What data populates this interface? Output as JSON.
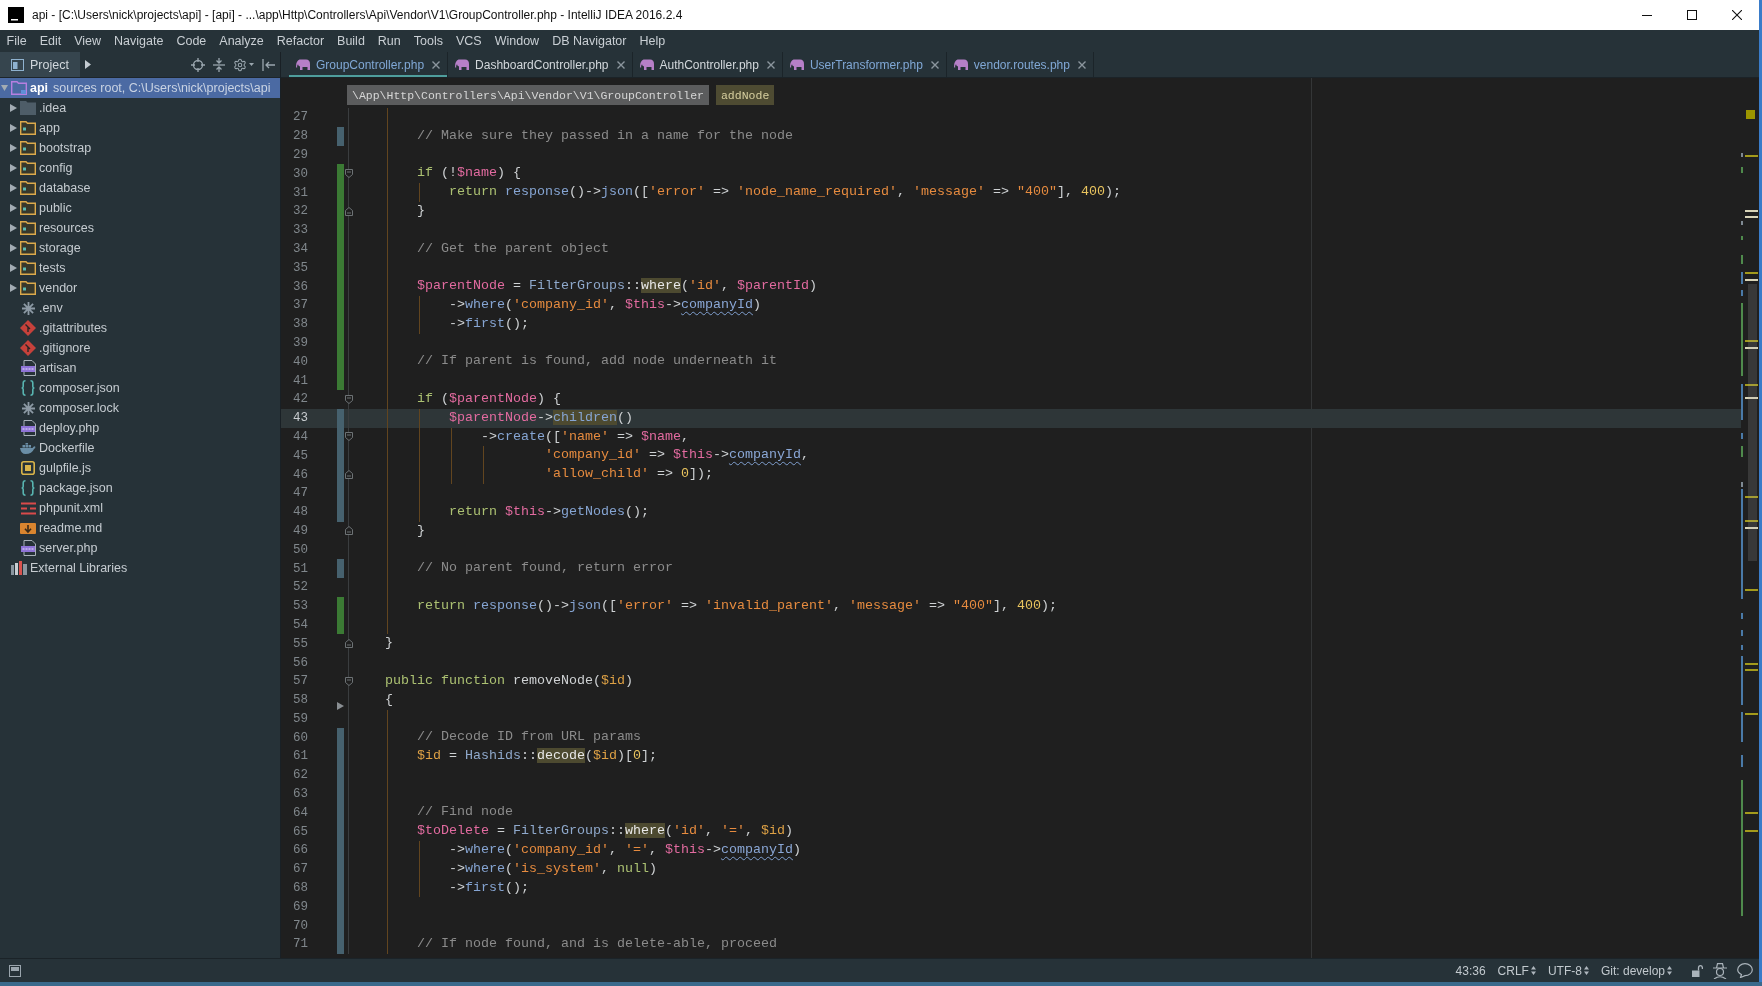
{
  "window": {
    "title": "api - [C:\\Users\\nick\\projects\\api] - [api] - ...\\app\\Http\\Controllers\\Api\\Vendor\\V1\\GroupController.php - IntelliJ IDEA 2016.2.4"
  },
  "menu": [
    "File",
    "Edit",
    "View",
    "Navigate",
    "Code",
    "Analyze",
    "Refactor",
    "Build",
    "Run",
    "Tools",
    "VCS",
    "Window",
    "DB Navigator",
    "Help"
  ],
  "project_panel": {
    "title": "Project",
    "tree": [
      {
        "kind": "module",
        "name": "api",
        "hint": "sources root, C:\\Users\\nick\\projects\\api",
        "expanded": true,
        "selected": true,
        "children": [
          {
            "kind": "excluded-folder",
            "name": ".idea",
            "expanded": false,
            "selected": false
          },
          {
            "kind": "folder",
            "name": "app",
            "expanded": false,
            "selected": false
          },
          {
            "kind": "folder",
            "name": "bootstrap",
            "expanded": false,
            "selected": false
          },
          {
            "kind": "folder",
            "name": "config",
            "expanded": false,
            "selected": false
          },
          {
            "kind": "folder",
            "name": "database",
            "expanded": false,
            "selected": false
          },
          {
            "kind": "folder",
            "name": "public",
            "expanded": false,
            "selected": false
          },
          {
            "kind": "folder",
            "name": "resources",
            "expanded": false,
            "selected": false
          },
          {
            "kind": "folder",
            "name": "storage",
            "expanded": false,
            "selected": false
          },
          {
            "kind": "folder",
            "name": "tests",
            "expanded": false,
            "selected": false
          },
          {
            "kind": "folder",
            "name": "vendor",
            "expanded": false,
            "selected": false
          },
          {
            "kind": "config",
            "name": ".env",
            "selected": false
          },
          {
            "kind": "git",
            "name": ".gitattributes",
            "selected": false
          },
          {
            "kind": "git",
            "name": ".gitignore",
            "selected": false
          },
          {
            "kind": "php",
            "name": "artisan",
            "selected": false
          },
          {
            "kind": "json",
            "name": "composer.json",
            "selected": false
          },
          {
            "kind": "config",
            "name": "composer.lock",
            "selected": false
          },
          {
            "kind": "php",
            "name": "deploy.php",
            "selected": false
          },
          {
            "kind": "docker",
            "name": "Dockerfile",
            "selected": false
          },
          {
            "kind": "js",
            "name": "gulpfile.js",
            "selected": false
          },
          {
            "kind": "json",
            "name": "package.json",
            "selected": false
          },
          {
            "kind": "xml",
            "name": "phpunit.xml",
            "selected": false
          },
          {
            "kind": "markdown",
            "name": "readme.md",
            "selected": false
          },
          {
            "kind": "php",
            "name": "server.php",
            "selected": false
          }
        ]
      },
      {
        "kind": "libraries",
        "name": "External Libraries",
        "selected": false
      }
    ]
  },
  "tabs": [
    {
      "label": "GroupController.php",
      "selected": true,
      "modified": true
    },
    {
      "label": "DashboardController.php",
      "selected": false,
      "modified": false
    },
    {
      "label": "AuthController.php",
      "selected": false,
      "modified": false
    },
    {
      "label": "UserTransformer.php",
      "selected": false,
      "modified": true
    },
    {
      "label": "vendor.routes.php",
      "selected": false,
      "modified": true
    }
  ],
  "breadcrumbs": [
    {
      "label": "\\App\\Http\\Controllers\\Api\\Vendor\\V1\\GroupController",
      "selected": false
    },
    {
      "label": "addNode",
      "selected": true
    }
  ],
  "editor": {
    "lines": [
      {
        "number": "27",
        "added": false,
        "modified": false,
        "deleted_below": false,
        "fold_start": false,
        "fold_end": false,
        "current": false
      },
      {
        "number": "28",
        "added": false,
        "modified": true,
        "deleted_below": false,
        "fold_start": false,
        "fold_end": false,
        "current": false,
        "tokens": [
          {
            "kind": "comment",
            "text": "        // Make sure they passed in a name for the node"
          }
        ]
      },
      {
        "number": "29",
        "added": false,
        "modified": false,
        "deleted_below": false,
        "fold_start": false,
        "fold_end": false,
        "current": false
      },
      {
        "number": "30",
        "added": true,
        "modified": false,
        "deleted_below": false,
        "fold_start": true,
        "fold_end": false,
        "current": false,
        "tokens": [
          {
            "kind": "keyword",
            "text": "        if"
          },
          {
            "kind": "plain",
            "text": " (!"
          },
          {
            "kind": "variable",
            "text": "$name"
          },
          {
            "kind": "plain",
            "text": ") {"
          }
        ]
      },
      {
        "number": "31",
        "added": true,
        "modified": false,
        "deleted_below": false,
        "fold_start": false,
        "fold_end": false,
        "current": false,
        "tokens": [
          {
            "kind": "keyword",
            "text": "            return "
          },
          {
            "kind": "call",
            "text": "response"
          },
          {
            "kind": "plain",
            "text": "()->"
          },
          {
            "kind": "call",
            "text": "json"
          },
          {
            "kind": "plain",
            "text": "(["
          },
          {
            "kind": "string",
            "text": "'error'"
          },
          {
            "kind": "plain",
            "text": " => "
          },
          {
            "kind": "string",
            "text": "'node_name_required'"
          },
          {
            "kind": "plain",
            "text": ", "
          },
          {
            "kind": "string",
            "text": "'message'"
          },
          {
            "kind": "plain",
            "text": " => "
          },
          {
            "kind": "string",
            "text": "\"400\""
          },
          {
            "kind": "plain",
            "text": "], "
          },
          {
            "kind": "number",
            "text": "400"
          },
          {
            "kind": "plain",
            "text": ");"
          }
        ]
      },
      {
        "number": "32",
        "added": true,
        "modified": false,
        "deleted_below": false,
        "fold_start": false,
        "fold_end": true,
        "current": false,
        "tokens": [
          {
            "kind": "plain",
            "text": "        }"
          }
        ]
      },
      {
        "number": "33",
        "added": true,
        "modified": false,
        "deleted_below": false,
        "fold_start": false,
        "fold_end": false,
        "current": false
      },
      {
        "number": "34",
        "added": true,
        "modified": false,
        "deleted_below": false,
        "fold_start": false,
        "fold_end": false,
        "current": false,
        "tokens": [
          {
            "kind": "comment",
            "text": "        // Get the parent object"
          }
        ]
      },
      {
        "number": "35",
        "added": true,
        "modified": false,
        "deleted_below": false,
        "fold_start": false,
        "fold_end": false,
        "current": false
      },
      {
        "number": "36",
        "added": true,
        "modified": false,
        "deleted_below": false,
        "fold_start": false,
        "fold_end": false,
        "current": false,
        "tokens": [
          {
            "kind": "variable",
            "text": "        $parentNode"
          },
          {
            "kind": "plain",
            "text": " = "
          },
          {
            "kind": "class",
            "text": "FilterGroups"
          },
          {
            "kind": "plain",
            "text": "::"
          },
          {
            "kind": "usage",
            "text": "where"
          },
          {
            "kind": "plain",
            "text": "("
          },
          {
            "kind": "string",
            "text": "'id'"
          },
          {
            "kind": "plain",
            "text": ", "
          },
          {
            "kind": "variable",
            "text": "$parentId"
          },
          {
            "kind": "plain",
            "text": ")"
          }
        ]
      },
      {
        "number": "37",
        "added": true,
        "modified": false,
        "deleted_below": false,
        "fold_start": false,
        "fold_end": false,
        "current": false,
        "tokens": [
          {
            "kind": "plain",
            "text": "            ->"
          },
          {
            "kind": "call",
            "text": "where"
          },
          {
            "kind": "plain",
            "text": "("
          },
          {
            "kind": "string",
            "text": "'company_id'"
          },
          {
            "kind": "plain",
            "text": ", "
          },
          {
            "kind": "variable",
            "text": "$this"
          },
          {
            "kind": "plain",
            "text": "->"
          },
          {
            "kind": "field-warning",
            "text": "companyId"
          },
          {
            "kind": "plain",
            "text": ")"
          }
        ]
      },
      {
        "number": "38",
        "added": true,
        "modified": false,
        "deleted_below": false,
        "fold_start": false,
        "fold_end": false,
        "current": false,
        "tokens": [
          {
            "kind": "plain",
            "text": "            ->"
          },
          {
            "kind": "call",
            "text": "first"
          },
          {
            "kind": "plain",
            "text": "();"
          }
        ]
      },
      {
        "number": "39",
        "added": true,
        "modified": false,
        "deleted_below": false,
        "fold_start": false,
        "fold_end": false,
        "current": false
      },
      {
        "number": "40",
        "added": true,
        "modified": false,
        "deleted_below": false,
        "fold_start": false,
        "fold_end": false,
        "current": false,
        "tokens": [
          {
            "kind": "comment",
            "text": "        // If parent is found, add node underneath it"
          }
        ]
      },
      {
        "number": "41",
        "added": true,
        "modified": false,
        "deleted_below": false,
        "fold_start": false,
        "fold_end": false,
        "current": false
      },
      {
        "number": "42",
        "added": false,
        "modified": false,
        "deleted_below": false,
        "fold_start": true,
        "fold_end": false,
        "current": false,
        "tokens": [
          {
            "kind": "keyword",
            "text": "        if"
          },
          {
            "kind": "plain",
            "text": " ("
          },
          {
            "kind": "variable",
            "text": "$parentNode"
          },
          {
            "kind": "plain",
            "text": ") {"
          }
        ]
      },
      {
        "number": "43",
        "added": false,
        "modified": true,
        "deleted_below": false,
        "fold_start": false,
        "fold_end": false,
        "current": true,
        "tokens": [
          {
            "kind": "variable",
            "text": "            $parentNode"
          },
          {
            "kind": "plain",
            "text": "->"
          },
          {
            "kind": "call-usage",
            "text": "children"
          },
          {
            "kind": "plain",
            "text": "()"
          }
        ]
      },
      {
        "number": "44",
        "added": false,
        "modified": true,
        "deleted_below": false,
        "fold_start": true,
        "fold_end": false,
        "current": false,
        "tokens": [
          {
            "kind": "plain",
            "text": "                ->"
          },
          {
            "kind": "call",
            "text": "create"
          },
          {
            "kind": "plain",
            "text": "(["
          },
          {
            "kind": "string",
            "text": "'name'"
          },
          {
            "kind": "plain",
            "text": " => "
          },
          {
            "kind": "variable",
            "text": "$name"
          },
          {
            "kind": "plain",
            "text": ","
          }
        ]
      },
      {
        "number": "45",
        "added": false,
        "modified": true,
        "deleted_below": false,
        "fold_start": false,
        "fold_end": false,
        "current": false,
        "tokens": [
          {
            "kind": "string",
            "text": "                        'company_id'"
          },
          {
            "kind": "plain",
            "text": " => "
          },
          {
            "kind": "variable",
            "text": "$this"
          },
          {
            "kind": "plain",
            "text": "->"
          },
          {
            "kind": "field-warning",
            "text": "companyId"
          },
          {
            "kind": "plain",
            "text": ","
          }
        ]
      },
      {
        "number": "46",
        "added": false,
        "modified": true,
        "deleted_below": false,
        "fold_start": false,
        "fold_end": true,
        "current": false,
        "tokens": [
          {
            "kind": "string",
            "text": "                        'allow_child'"
          },
          {
            "kind": "plain",
            "text": " => "
          },
          {
            "kind": "number",
            "text": "0"
          },
          {
            "kind": "plain",
            "text": "]);"
          }
        ]
      },
      {
        "number": "47",
        "added": false,
        "modified": true,
        "deleted_below": false,
        "fold_start": false,
        "fold_end": false,
        "current": false
      },
      {
        "number": "48",
        "added": false,
        "modified": true,
        "deleted_below": false,
        "fold_start": false,
        "fold_end": false,
        "current": false,
        "tokens": [
          {
            "kind": "keyword",
            "text": "            return "
          },
          {
            "kind": "variable",
            "text": "$this"
          },
          {
            "kind": "plain",
            "text": "->"
          },
          {
            "kind": "call",
            "text": "getNodes"
          },
          {
            "kind": "plain",
            "text": "();"
          }
        ]
      },
      {
        "number": "49",
        "added": false,
        "modified": false,
        "deleted_below": false,
        "fold_start": false,
        "fold_end": true,
        "current": false,
        "tokens": [
          {
            "kind": "plain",
            "text": "        }"
          }
        ]
      },
      {
        "number": "50",
        "added": false,
        "modified": false,
        "deleted_below": false,
        "fold_start": false,
        "fold_end": false,
        "current": false
      },
      {
        "number": "51",
        "added": false,
        "modified": true,
        "deleted_below": false,
        "fold_start": false,
        "fold_end": false,
        "current": false,
        "tokens": [
          {
            "kind": "comment",
            "text": "        // No parent found, return error"
          }
        ]
      },
      {
        "number": "52",
        "added": false,
        "modified": false,
        "deleted_below": false,
        "fold_start": false,
        "fold_end": false,
        "current": false
      },
      {
        "number": "53",
        "added": true,
        "modified": false,
        "deleted_below": false,
        "fold_start": false,
        "fold_end": false,
        "current": false,
        "tokens": [
          {
            "kind": "keyword",
            "text": "        return "
          },
          {
            "kind": "call",
            "text": "response"
          },
          {
            "kind": "plain",
            "text": "()->"
          },
          {
            "kind": "call",
            "text": "json"
          },
          {
            "kind": "plain",
            "text": "(["
          },
          {
            "kind": "string",
            "text": "'error'"
          },
          {
            "kind": "plain",
            "text": " => "
          },
          {
            "kind": "string",
            "text": "'invalid_parent'"
          },
          {
            "kind": "plain",
            "text": ", "
          },
          {
            "kind": "string",
            "text": "'message'"
          },
          {
            "kind": "plain",
            "text": " => "
          },
          {
            "kind": "string",
            "text": "\"400\""
          },
          {
            "kind": "plain",
            "text": "], "
          },
          {
            "kind": "number",
            "text": "400"
          },
          {
            "kind": "plain",
            "text": ");"
          }
        ]
      },
      {
        "number": "54",
        "added": true,
        "modified": false,
        "deleted_below": false,
        "fold_start": false,
        "fold_end": false,
        "current": false
      },
      {
        "number": "55",
        "added": false,
        "modified": false,
        "deleted_below": false,
        "fold_start": false,
        "fold_end": true,
        "current": false,
        "tokens": [
          {
            "kind": "plain",
            "text": "    }"
          }
        ]
      },
      {
        "number": "56",
        "added": false,
        "modified": false,
        "deleted_below": false,
        "fold_start": false,
        "fold_end": false,
        "current": false
      },
      {
        "number": "57",
        "added": false,
        "modified": false,
        "deleted_below": false,
        "fold_start": true,
        "fold_end": false,
        "current": false,
        "tokens": [
          {
            "kind": "keyword",
            "text": "    public function "
          },
          {
            "kind": "plain",
            "text": "removeNode("
          },
          {
            "kind": "parameter",
            "text": "$id"
          },
          {
            "kind": "plain",
            "text": ")"
          }
        ]
      },
      {
        "number": "58",
        "added": false,
        "modified": false,
        "deleted_below": true,
        "fold_start": false,
        "fold_end": false,
        "current": false,
        "tokens": [
          {
            "kind": "plain",
            "text": "    {"
          }
        ]
      },
      {
        "number": "59",
        "added": false,
        "modified": false,
        "deleted_below": false,
        "fold_start": false,
        "fold_end": false,
        "current": false
      },
      {
        "number": "60",
        "added": false,
        "modified": true,
        "deleted_below": false,
        "fold_start": false,
        "fold_end": false,
        "current": false,
        "tokens": [
          {
            "kind": "comment",
            "text": "        // Decode ID from URL params"
          }
        ]
      },
      {
        "number": "61",
        "added": false,
        "modified": true,
        "deleted_below": false,
        "fold_start": false,
        "fold_end": false,
        "current": false,
        "tokens": [
          {
            "kind": "parameter",
            "text": "        $id"
          },
          {
            "kind": "plain",
            "text": " = "
          },
          {
            "kind": "class",
            "text": "Hashids"
          },
          {
            "kind": "plain",
            "text": "::"
          },
          {
            "kind": "usage",
            "text": "decode"
          },
          {
            "kind": "plain",
            "text": "("
          },
          {
            "kind": "parameter",
            "text": "$id"
          },
          {
            "kind": "plain",
            "text": ")["
          },
          {
            "kind": "number",
            "text": "0"
          },
          {
            "kind": "plain",
            "text": "];"
          }
        ]
      },
      {
        "number": "62",
        "added": false,
        "modified": true,
        "deleted_below": false,
        "fold_start": false,
        "fold_end": false,
        "current": false
      },
      {
        "number": "63",
        "added": false,
        "modified": true,
        "deleted_below": false,
        "fold_start": false,
        "fold_end": false,
        "current": false
      },
      {
        "number": "64",
        "added": false,
        "modified": true,
        "deleted_below": false,
        "fold_start": false,
        "fold_end": false,
        "current": false,
        "tokens": [
          {
            "kind": "comment",
            "text": "        // Find node"
          }
        ]
      },
      {
        "number": "65",
        "added": false,
        "modified": true,
        "deleted_below": false,
        "fold_start": false,
        "fold_end": false,
        "current": false,
        "tokens": [
          {
            "kind": "variable",
            "text": "        $toDelete"
          },
          {
            "kind": "plain",
            "text": " = "
          },
          {
            "kind": "class",
            "text": "FilterGroups"
          },
          {
            "kind": "plain",
            "text": "::"
          },
          {
            "kind": "usage",
            "text": "where"
          },
          {
            "kind": "plain",
            "text": "("
          },
          {
            "kind": "string",
            "text": "'id'"
          },
          {
            "kind": "plain",
            "text": ", "
          },
          {
            "kind": "string",
            "text": "'='"
          },
          {
            "kind": "plain",
            "text": ", "
          },
          {
            "kind": "parameter",
            "text": "$id"
          },
          {
            "kind": "plain",
            "text": ")"
          }
        ]
      },
      {
        "number": "66",
        "added": false,
        "modified": true,
        "deleted_below": false,
        "fold_start": false,
        "fold_end": false,
        "current": false,
        "tokens": [
          {
            "kind": "plain",
            "text": "            ->"
          },
          {
            "kind": "call",
            "text": "where"
          },
          {
            "kind": "plain",
            "text": "("
          },
          {
            "kind": "string",
            "text": "'company_id'"
          },
          {
            "kind": "plain",
            "text": ", "
          },
          {
            "kind": "string",
            "text": "'='"
          },
          {
            "kind": "plain",
            "text": ", "
          },
          {
            "kind": "variable",
            "text": "$this"
          },
          {
            "kind": "plain",
            "text": "->"
          },
          {
            "kind": "field-warning",
            "text": "companyId"
          },
          {
            "kind": "plain",
            "text": ")"
          }
        ]
      },
      {
        "number": "67",
        "added": false,
        "modified": true,
        "deleted_below": false,
        "fold_start": false,
        "fold_end": false,
        "current": false,
        "tokens": [
          {
            "kind": "plain",
            "text": "            ->"
          },
          {
            "kind": "call",
            "text": "where"
          },
          {
            "kind": "plain",
            "text": "("
          },
          {
            "kind": "string",
            "text": "'is_system'"
          },
          {
            "kind": "plain",
            "text": ", "
          },
          {
            "kind": "keyword",
            "text": "null"
          },
          {
            "kind": "plain",
            "text": ")"
          }
        ]
      },
      {
        "number": "68",
        "added": false,
        "modified": true,
        "deleted_below": false,
        "fold_start": false,
        "fold_end": false,
        "current": false,
        "tokens": [
          {
            "kind": "plain",
            "text": "            ->"
          },
          {
            "kind": "call",
            "text": "first"
          },
          {
            "kind": "plain",
            "text": "();"
          }
        ]
      },
      {
        "number": "69",
        "added": false,
        "modified": true,
        "deleted_below": false,
        "fold_start": false,
        "fold_end": false,
        "current": false
      },
      {
        "number": "70",
        "added": false,
        "modified": true,
        "deleted_below": false,
        "fold_start": false,
        "fold_end": false,
        "current": false
      },
      {
        "number": "71",
        "added": false,
        "modified": true,
        "deleted_below": false,
        "fold_start": false,
        "fold_end": false,
        "current": false,
        "tokens": [
          {
            "kind": "comment",
            "text": "        // If node found, and is delete-able, proceed"
          }
        ]
      }
    ]
  },
  "status_bar": {
    "position": "43:36",
    "line_separator": "CRLF",
    "encoding": "UTF-8",
    "vcs_branch": "Git: develop"
  }
}
